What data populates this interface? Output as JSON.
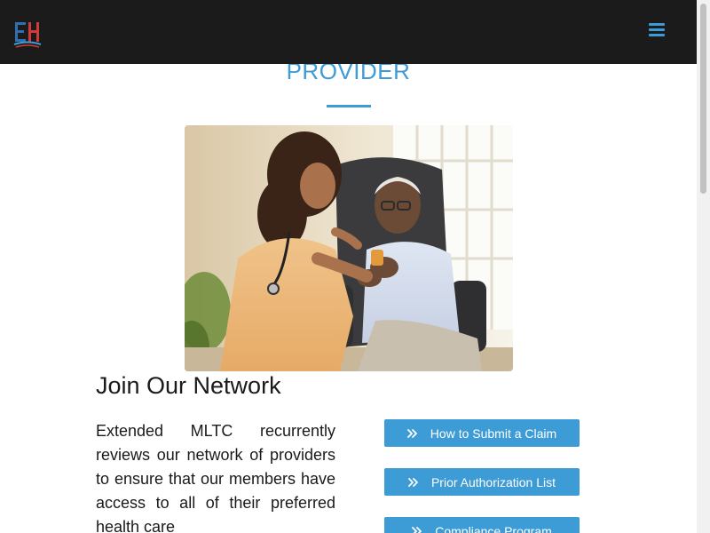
{
  "header": {
    "logo_alt": "EH",
    "menu_icon": "hamburger-menu-icon",
    "accent_color": "#3d9bd5",
    "background_color": "#1b1b1b"
  },
  "page": {
    "heading": "PROVIDER"
  },
  "hero": {
    "image_name": "nurse-with-patient-photo"
  },
  "section": {
    "title": "Join Our Network",
    "body": "Extended MLTC recurrently reviews our network of providers to ensure that our members have access to all of their preferred health care"
  },
  "links": [
    {
      "label": "How to Submit a Claim",
      "icon": "double-chevron-right-icon"
    },
    {
      "label": "Prior Authorization List",
      "icon": "double-chevron-right-icon"
    },
    {
      "label": "Compliance Program",
      "icon": "double-chevron-right-icon"
    }
  ]
}
